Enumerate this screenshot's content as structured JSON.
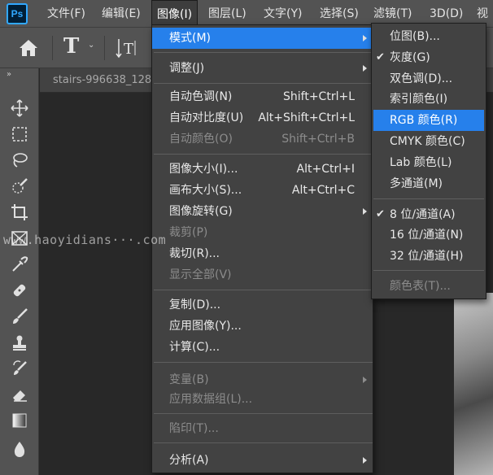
{
  "app": {
    "logo_text": "Ps"
  },
  "menubar": {
    "items": [
      {
        "label": "文件(F)"
      },
      {
        "label": "编辑(E)"
      },
      {
        "label": "图像(I)"
      },
      {
        "label": "图层(L)"
      },
      {
        "label": "文字(Y)"
      },
      {
        "label": "选择(S)"
      },
      {
        "label": "滤镜(T)"
      },
      {
        "label": "3D(D)"
      },
      {
        "label": "视"
      }
    ]
  },
  "options_bar": {
    "home_icon": "home-icon",
    "type_tool_glyph": "T",
    "type_orientation_icon": "text-orientation-icon"
  },
  "document": {
    "tab_title": "stairs-996638_128"
  },
  "watermark": {
    "text": "www.haoyidians···.com"
  },
  "image_menu": {
    "items": [
      {
        "label": "模式(M)",
        "submenu": true,
        "highlight": true
      },
      {
        "label": "调整(J)",
        "submenu": true
      },
      {
        "label": "自动色调(N)",
        "shortcut": "Shift+Ctrl+L"
      },
      {
        "label": "自动对比度(U)",
        "shortcut": "Alt+Shift+Ctrl+L"
      },
      {
        "label": "自动颜色(O)",
        "shortcut": "Shift+Ctrl+B",
        "disabled": true
      },
      {
        "label": "图像大小(I)...",
        "shortcut": "Alt+Ctrl+I"
      },
      {
        "label": "画布大小(S)...",
        "shortcut": "Alt+Ctrl+C"
      },
      {
        "label": "图像旋转(G)",
        "submenu": true
      },
      {
        "label": "裁剪(P)",
        "disabled": true
      },
      {
        "label": "裁切(R)..."
      },
      {
        "label": "显示全部(V)",
        "disabled": true
      },
      {
        "label": "复制(D)..."
      },
      {
        "label": "应用图像(Y)..."
      },
      {
        "label": "计算(C)..."
      },
      {
        "label": "变量(B)",
        "submenu": true,
        "disabled": true
      },
      {
        "label": "应用数据组(L)...",
        "disabled": true
      },
      {
        "label": "陷印(T)...",
        "disabled": true
      },
      {
        "label": "分析(A)",
        "submenu": true
      }
    ]
  },
  "mode_submenu": {
    "items": [
      {
        "label": "位图(B)..."
      },
      {
        "label": "灰度(G)",
        "checked": true
      },
      {
        "label": "双色调(D)..."
      },
      {
        "label": "索引颜色(I)"
      },
      {
        "label": "RGB 颜色(R)",
        "highlight": true
      },
      {
        "label": "CMYK 颜色(C)"
      },
      {
        "label": "Lab 颜色(L)"
      },
      {
        "label": "多通道(M)"
      },
      {
        "label": "8 位/通道(A)",
        "checked": true
      },
      {
        "label": "16 位/通道(N)"
      },
      {
        "label": "32 位/通道(H)"
      },
      {
        "label": "颜色表(T)...",
        "disabled": true
      }
    ]
  },
  "colors": {
    "highlight": "#2680eb",
    "menu_bg": "#424242",
    "chrome_bg": "#535353",
    "canvas_bg": "#282828",
    "ps_logo_blue": "#31a8ff"
  }
}
